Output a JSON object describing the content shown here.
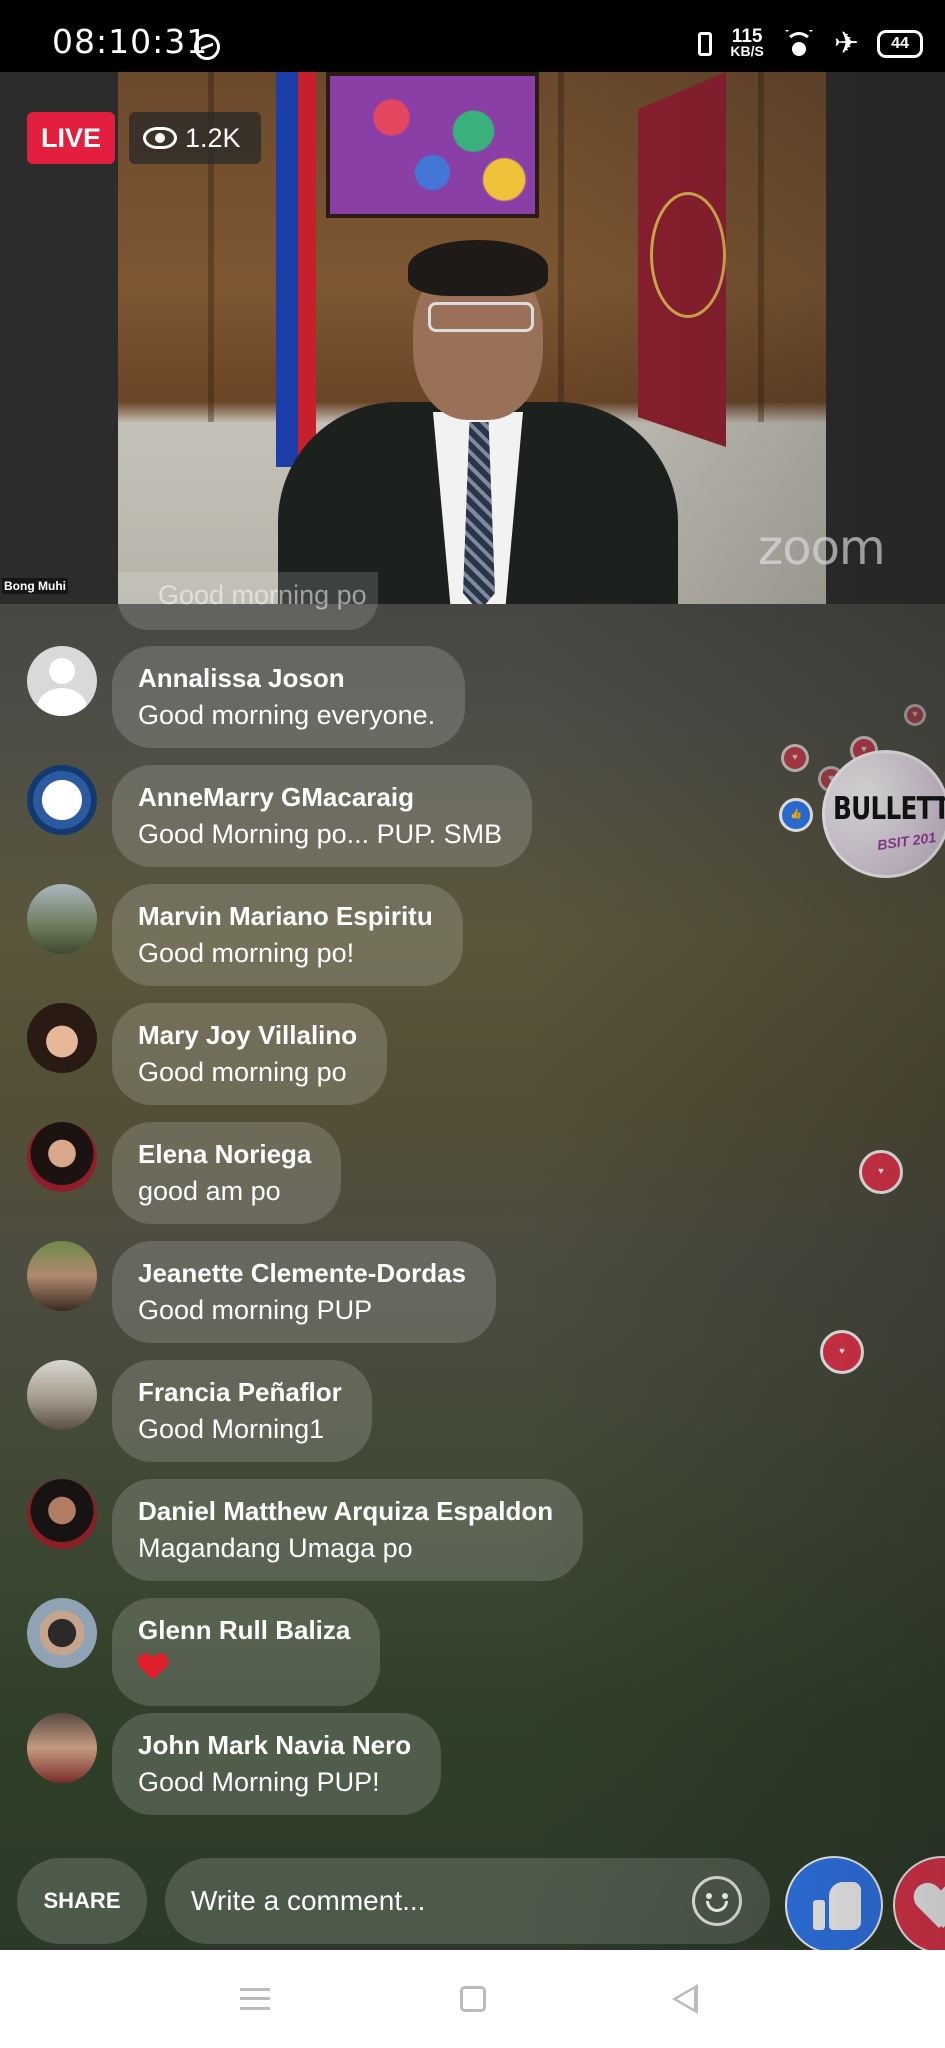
{
  "status_bar": {
    "time": "08:10:31",
    "net_speed_value": "115",
    "net_speed_unit": "KB/S",
    "battery": "44"
  },
  "stream": {
    "live_label": "LIVE",
    "viewer_count": "1.2K",
    "participant_name": "Bong Muhi",
    "watermark": "zoom",
    "partial_comment": "Good morning po"
  },
  "comments": [
    {
      "name": "Annalissa Joson",
      "text": "Good morning everyone."
    },
    {
      "name": "AnneMarry GMacaraig",
      "text": "Good Morning po... PUP. SMB"
    },
    {
      "name": "Marvin Mariano Espiritu",
      "text": "Good morning po!"
    },
    {
      "name": "Mary Joy Villalino",
      "text": "Good morning po"
    },
    {
      "name": "Elena Noriega",
      "text": "good am po"
    },
    {
      "name": "Jeanette Clemente-Dordas",
      "text": "Good morning PUP"
    },
    {
      "name": "Francia Peñaflor",
      "text": "Good Morning1"
    },
    {
      "name": "Daniel Matthew Arquiza Espaldon",
      "text": "Magandang Umaga po"
    },
    {
      "name": "Glenn Rull Baliza",
      "text": "",
      "emoji": "red-heart-emoji"
    },
    {
      "name": "John Mark Navia Nero",
      "text": "Good Morning PUP!"
    }
  ],
  "floating": {
    "bulletin_title": "BULLETTI",
    "bulletin_sub": "BSIT 201"
  },
  "composer": {
    "share_label": "SHARE",
    "input_placeholder": "Write a comment..."
  },
  "colors": {
    "live_red": "#e41e3f",
    "like_blue": "#2e78f0",
    "love_red": "#e8344b"
  }
}
